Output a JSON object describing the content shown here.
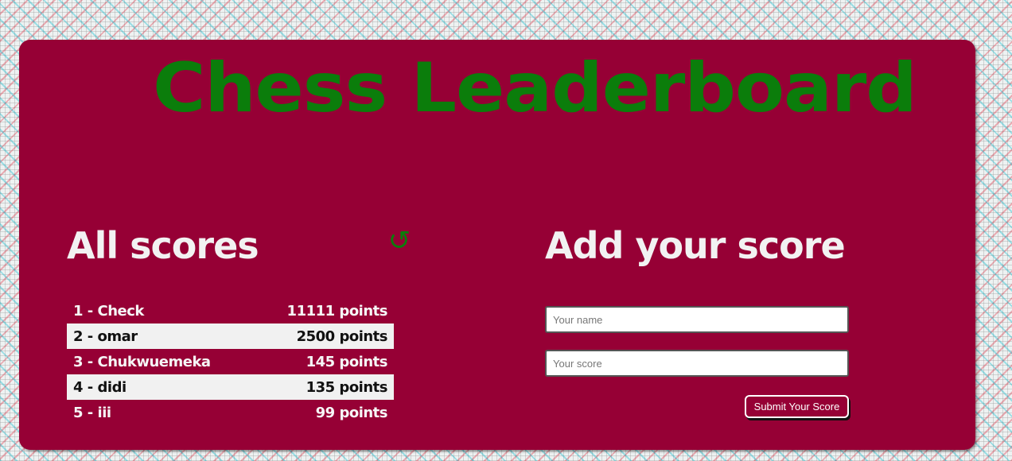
{
  "page_title": "Chess Leaderboard",
  "scores_section": {
    "heading": "All scores",
    "refresh_icon": "refresh-icon",
    "entries": [
      {
        "rank_name": "1 - Check",
        "points": "11111 points"
      },
      {
        "rank_name": "2 - omar",
        "points": "2500 points"
      },
      {
        "rank_name": "3 - Chukwuemeka",
        "points": "145 points"
      },
      {
        "rank_name": "4 - didi",
        "points": "135 points"
      },
      {
        "rank_name": "5 - iii",
        "points": "99 points"
      }
    ]
  },
  "add_section": {
    "heading": "Add your score",
    "name_placeholder": "Your name",
    "name_value": "",
    "score_placeholder": "Your score",
    "score_value": "",
    "submit_label": "Submit Your Score"
  },
  "colors": {
    "panel_bg": "#960035",
    "title_green": "#0b7d0b",
    "heading_text": "#f2f2f2",
    "row_highlight": "#f1f1f1"
  }
}
